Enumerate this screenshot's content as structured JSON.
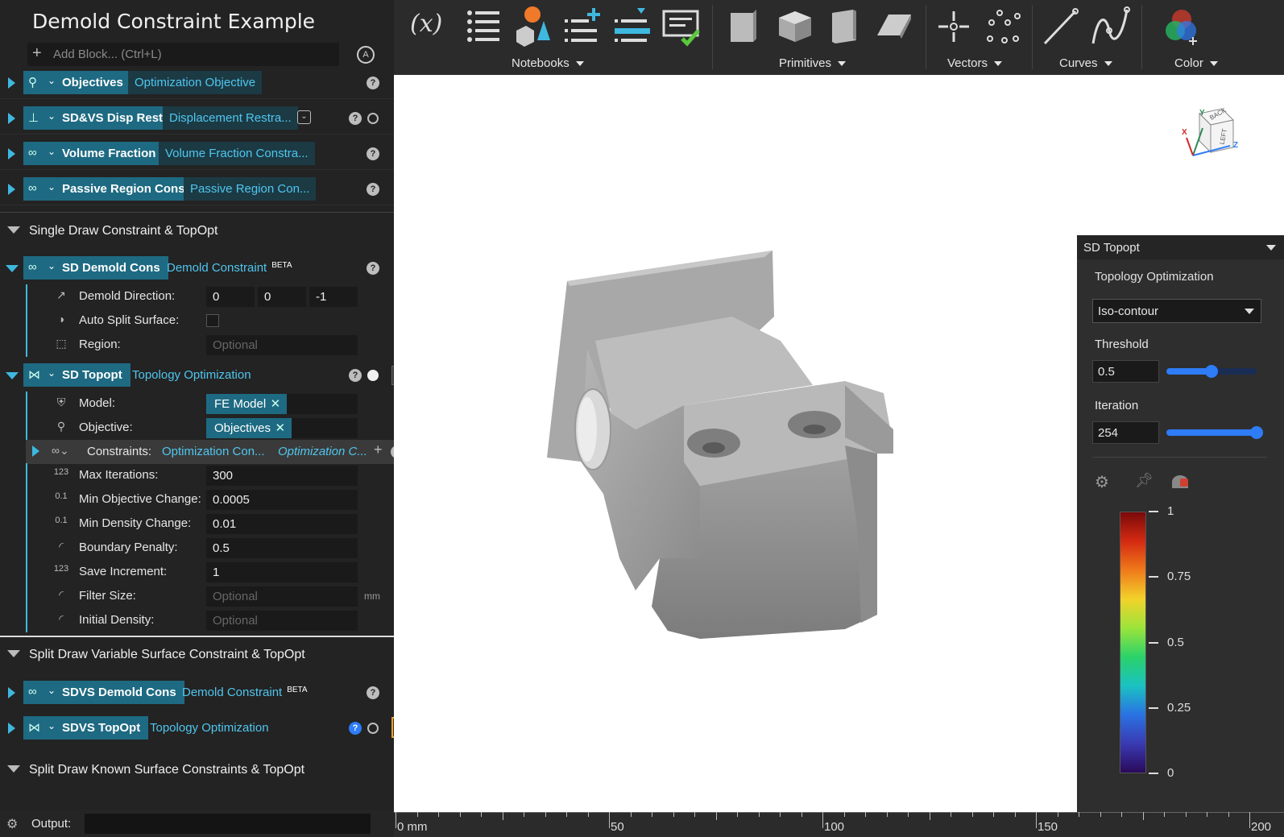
{
  "app": {
    "title": "Demold Constraint Example",
    "add_block_placeholder": "Add Block... (Ctrl+L)"
  },
  "blocks": {
    "objectives": {
      "name": "Objectives",
      "type": "Optimization Objective"
    },
    "sdvs_disp": {
      "name": "SD&VS Disp Rest",
      "type": "Displacement Restra..."
    },
    "volume_fraction": {
      "name": "Volume Fraction",
      "type": "Volume Fraction Constra..."
    },
    "passive_region": {
      "name": "Passive Region Cons",
      "type": "Passive Region Con..."
    }
  },
  "section1": {
    "title": "Single Draw Constraint & TopOpt",
    "demold": {
      "name": "SD Demold Cons",
      "type": "Demold Constraint",
      "beta": "BETA",
      "direction_label": "Demold Direction:",
      "direction": [
        "0",
        "0",
        "-1"
      ],
      "auto_split_label": "Auto Split Surface:",
      "region_label": "Region:",
      "region_placeholder": "Optional"
    },
    "topopt": {
      "name": "SD Topopt",
      "type": "Topology Optimization",
      "model_label": "Model:",
      "model_value": "FE Model",
      "objective_label": "Objective:",
      "objective_value": "Objectives",
      "constraints_label": "Constraints:",
      "constraints_value1": "Optimization Con...",
      "constraints_value2": "Optimization C...",
      "max_iter_label": "Max Iterations:",
      "max_iter": "300",
      "min_obj_label": "Min Objective Change:",
      "min_obj": "0.0005",
      "min_density_label": "Min Density Change:",
      "min_density": "0.01",
      "boundary_label": "Boundary Penalty:",
      "boundary": "0.5",
      "save_inc_label": "Save Increment:",
      "save_inc": "1",
      "filter_label": "Filter Size:",
      "filter_placeholder": "Optional",
      "filter_unit": "mm",
      "init_density_label": "Initial Density:",
      "init_density_placeholder": "Optional"
    }
  },
  "section2": {
    "title": "Split Draw Variable Surface Constraint & TopOpt",
    "demold": {
      "name": "SDVS Demold Cons",
      "type": "Demold Constraint",
      "beta": "BETA"
    },
    "topopt": {
      "name": "SDVS TopOpt",
      "type": "Topology Optimization"
    }
  },
  "section3": {
    "title": "Split Draw Known Surface Constraints & TopOpt"
  },
  "output": {
    "label": "Output:"
  },
  "toolbar": {
    "groups": [
      "Notebooks",
      "Primitives",
      "Vectors",
      "Curves",
      "Color"
    ],
    "variable_label": "(x)"
  },
  "viewcube": {
    "top": "BACK",
    "side": "LEFT",
    "axis_y": "Y",
    "axis_z": "Z",
    "axis_x": "X"
  },
  "ruler": {
    "labels": [
      "0 mm",
      "50",
      "100",
      "150",
      "200"
    ]
  },
  "panel": {
    "title": "SD Topopt",
    "subtitle": "Topology Optimization",
    "mode": "Iso-contour",
    "threshold_label": "Threshold",
    "threshold_value": "0.5",
    "threshold_fraction": 0.5,
    "iteration_label": "Iteration",
    "iteration_value": "254",
    "iteration_fraction": 1.0,
    "colorbar_ticks": [
      "1",
      "0.75",
      "0.5",
      "0.25",
      "0"
    ]
  },
  "colors": {
    "accent": "#3fb8e0",
    "chip": "#1e6a82",
    "slider": "#2e7cf6"
  }
}
